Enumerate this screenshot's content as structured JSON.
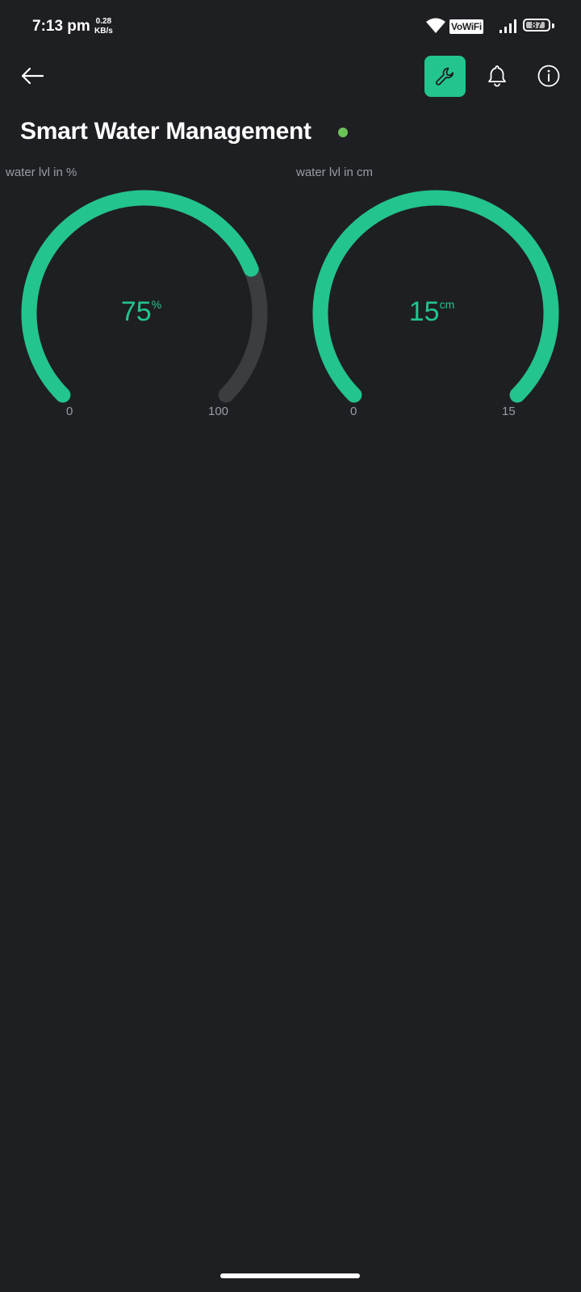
{
  "status_bar": {
    "time": "7:13 pm",
    "net_speed_value": "0.28",
    "net_speed_unit": "KB/s",
    "vowifi_label": "VoWiFi",
    "battery_level": "87"
  },
  "header": {
    "back_icon": "arrow-left-icon",
    "settings_icon": "wrench-icon",
    "notifications_icon": "bell-icon",
    "info_icon": "info-icon",
    "accent_color": "#23c48e"
  },
  "page": {
    "title": "Smart Water Management",
    "status_color": "#6ac259"
  },
  "gauges": [
    {
      "label": "water lvl in %",
      "value": "75",
      "unit": "%",
      "min": "0",
      "max": "100",
      "fraction": 0.75
    },
    {
      "label": "water lvl in cm",
      "value": "15",
      "unit": "cm",
      "min": "0",
      "max": "15",
      "fraction": 1.0
    }
  ],
  "colors": {
    "background": "#1e1f22",
    "gauge_fill": "#23c48e",
    "gauge_track": "#3c3d41",
    "muted_text": "#9a9ca3"
  }
}
